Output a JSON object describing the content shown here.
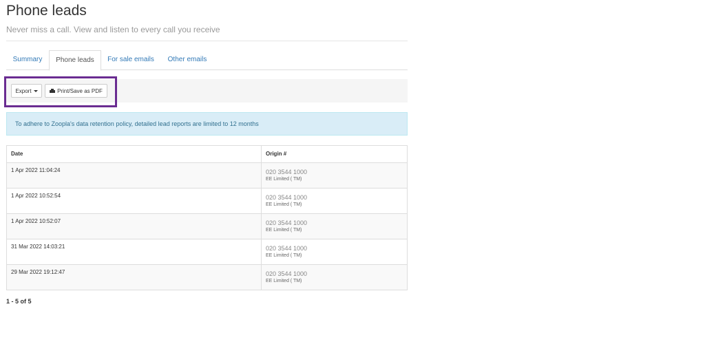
{
  "header": {
    "title": "Phone leads",
    "subtitle": "Never miss a call. View and listen to every call you receive"
  },
  "tabs": [
    {
      "label": "Summary",
      "active": false
    },
    {
      "label": "Phone leads",
      "active": true
    },
    {
      "label": "For sale emails",
      "active": false
    },
    {
      "label": "Other emails",
      "active": false
    }
  ],
  "toolbar": {
    "export_label": "Export",
    "print_label": "Print/Save as PDF"
  },
  "alert": {
    "text": "To adhere to Zoopla's data retention policy, detailed lead reports are limited to 12 months"
  },
  "table": {
    "columns": [
      "Date",
      "Origin #"
    ],
    "rows": [
      {
        "date": "1 Apr 2022 11:04:24",
        "number": "020 3544 1000",
        "carrier": "EE Limited ( TM)"
      },
      {
        "date": "1 Apr 2022 10:52:54",
        "number": "020 3544 1000",
        "carrier": "EE Limited ( TM)"
      },
      {
        "date": "1 Apr 2022 10:52:07",
        "number": "020 3544 1000",
        "carrier": "EE Limited ( TM)"
      },
      {
        "date": "31 Mar 2022 14:03:21",
        "number": "020 3544 1000",
        "carrier": "EE Limited ( TM)"
      },
      {
        "date": "29 Mar 2022 19:12:47",
        "number": "020 3544 1000",
        "carrier": "EE Limited ( TM)"
      }
    ]
  },
  "pagination": {
    "text": "1 - 5 of 5"
  },
  "colors": {
    "highlight": "#6a2c91",
    "link": "#337ab7",
    "alert_bg": "#d9edf7"
  },
  "icons": {
    "export": "caret-down-icon",
    "print": "printer-icon"
  }
}
